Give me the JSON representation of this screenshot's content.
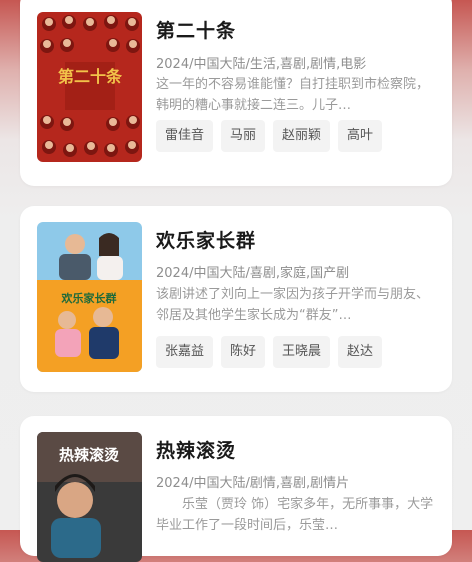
{
  "movies": [
    {
      "title": "第二十条",
      "meta": "2024/中国大陆/生活,喜剧,剧情,电影",
      "description": "这一年的不容易谁能懂？自打挂职到市检察院，韩明的糟心事就接二连三。儿子…",
      "cast": [
        "雷佳音",
        "马丽",
        "赵丽颖",
        "高叶"
      ],
      "poster_text": "第二十条"
    },
    {
      "title": "欢乐家长群",
      "meta": "2024/中国大陆/喜剧,家庭,国产剧",
      "description": "该剧讲述了刘向上一家因为孩子开学而与朋友、邻居及其他学生家长成为“群友”…",
      "cast": [
        "张嘉益",
        "陈好",
        "王晓晨",
        "赵达"
      ],
      "poster_text": "欢乐家长群"
    },
    {
      "title": "热辣滚烫",
      "meta": "2024/中国大陆/剧情,喜剧,剧情片",
      "description": "乐莹（贾玲 饰）宅家多年，无所事事，大学毕业工作了一段时间后，乐莹…",
      "cast": [],
      "poster_text": "热辣滚烫"
    }
  ],
  "colors": {
    "header_red": "#c65752",
    "poster1_red": "#b5271d",
    "poster1_gold": "#f2c34a",
    "poster2_sky": "#8ec9e9",
    "poster2_orange": "#f4a024",
    "poster3_dark": "#3a3a3a"
  }
}
